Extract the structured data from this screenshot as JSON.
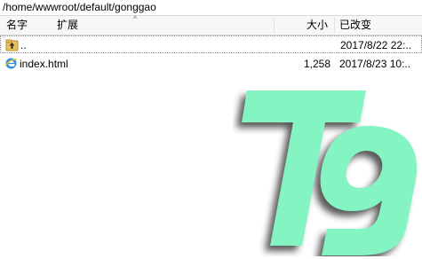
{
  "path": "/home/wwwroot/default/gonggao",
  "columns": {
    "name": "名字",
    "ext": "扩展",
    "size": "大小",
    "modified": "已改变"
  },
  "rows": [
    {
      "icon": "parent-folder-icon",
      "name": "..",
      "size": "",
      "modified": "2017/8/22 22:.."
    },
    {
      "icon": "ie-html-file-icon",
      "name": "index.html",
      "size": "1,258",
      "modified": "2017/8/23 10:.."
    }
  ],
  "watermark": {
    "text": "T9",
    "color": "#84f4c2",
    "shadow": "#2e2e2e"
  }
}
